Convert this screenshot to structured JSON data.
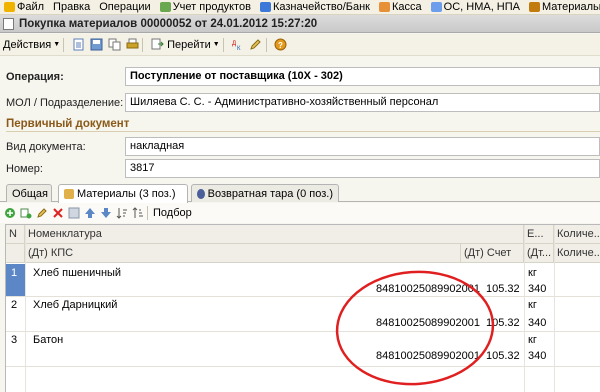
{
  "menu": [
    {
      "label": "Файл",
      "icon": "file-icon",
      "color": "#f0b400"
    },
    {
      "label": "Правка",
      "icon": "",
      "color": ""
    },
    {
      "label": "Операции",
      "icon": "",
      "color": ""
    },
    {
      "label": "Учет продуктов",
      "icon": "food-icon",
      "color": "#6aa84f"
    },
    {
      "label": "Казначейство/Банк",
      "icon": "bank-icon",
      "color": "#3c78d8"
    },
    {
      "label": "Касса",
      "icon": "cash-icon",
      "color": "#e69138"
    },
    {
      "label": "ОС, НМА, НПА",
      "icon": "car-icon",
      "color": "#6d9eeb"
    },
    {
      "label": "Материальн",
      "icon": "box-icon",
      "color": "#c27c0e"
    }
  ],
  "window": {
    "title": "Покупка материалов 00000052 от 24.01.2012 15:27:20"
  },
  "toolbar": {
    "actions_label": "Действия",
    "goto_label": "Перейти"
  },
  "form": {
    "operation_label": "Операция:",
    "operation_value": "Поступление от поставщика (10Х - 302)",
    "mol_label": "МОЛ / Подразделение:",
    "mol_value": "Шиляева С. С. - Административно-хозяйственный персонал",
    "primary_section": "Первичный документ",
    "doc_type_label": "Вид документа:",
    "doc_type_value": "накладная",
    "number_label": "Номер:",
    "number_value": "3817"
  },
  "tabs": [
    {
      "label": "Общая"
    },
    {
      "label": "Материалы (3 поз.)"
    },
    {
      "label": "Возвратная тара (0 поз.)"
    }
  ],
  "grid_toolbar": {
    "selection_label": "Подбор"
  },
  "table": {
    "headers": {
      "n": "N",
      "nomenclature": "Номенклатура",
      "kps": "(Дт) КПС",
      "account": "(Дт) Счет",
      "unit_top": "Е...",
      "unit_bottom": "(Дт...",
      "qty_top": "Количе...",
      "qty_bottom": "Количе..."
    },
    "rows": [
      {
        "n": "1",
        "name": "Хлеб пшеничный",
        "kps": "84810025089902001",
        "account": "105.32",
        "unit": "кг",
        "unit_code": "340"
      },
      {
        "n": "2",
        "name": "Хлеб Дарницкий",
        "kps": "84810025089902001",
        "account": "105.32",
        "unit": "кг",
        "unit_code": "340"
      },
      {
        "n": "3",
        "name": "Батон",
        "kps": "84810025089902001",
        "account": "105.32",
        "unit": "кг",
        "unit_code": "340"
      }
    ]
  },
  "colors": {
    "annotation_ellipse": "#e02020",
    "selected_row_marker": "#5b87c6",
    "section_title": "#8a5a1a"
  }
}
